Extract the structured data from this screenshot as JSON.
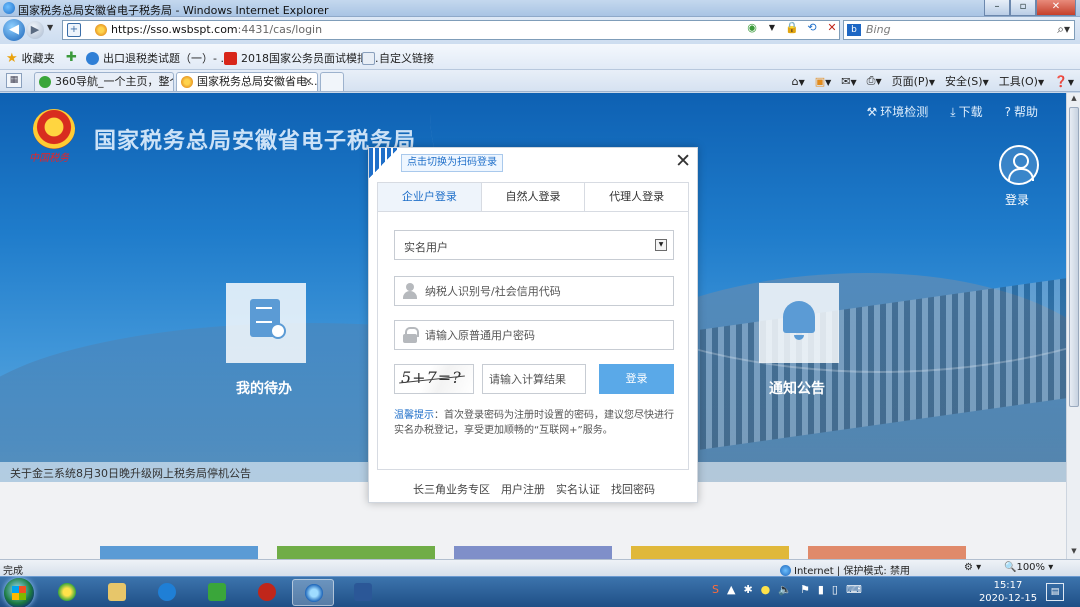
{
  "window": {
    "title": "国家税务总局安徽省电子税务局 - Windows Internet Explorer",
    "min_label": "–",
    "max_label": "▫",
    "close_label": "✕"
  },
  "addressbar": {
    "url_host": "https://sso.wsbspt.com",
    "url_path": ":4431/cas/login",
    "search_placeholder": "Bing",
    "back_glyph": "◀",
    "forward_glyph": "▶"
  },
  "favorites": {
    "label": "收藏夹",
    "items": [
      "出口退税类试题（一）- ...",
      "2018国家公务员面试模拟...",
      "自定义链接"
    ]
  },
  "tabs": [
    {
      "label": "360导航_一个主页，整个..."
    },
    {
      "label": "国家税务总局安徽省电..."
    }
  ],
  "commandbar": {
    "page": "页面(P)",
    "safety": "安全(S)",
    "tools": "工具(O)"
  },
  "site": {
    "title": "国家税务总局安徽省电子税务局",
    "logo_signature": "中国税务",
    "toplinks": [
      "环境检测",
      "下载",
      "帮助"
    ],
    "user_label": "登录",
    "tile_todo": "我的待办",
    "tile_notice": "通知公告",
    "news": "关于金三系统8月30日晚升级网上税务局停机公告"
  },
  "login": {
    "qr_tip": "点击切换为扫码登录",
    "close": "✕",
    "tabs": [
      "企业户登录",
      "自然人登录",
      "代理人登录"
    ],
    "active_tab": 0,
    "select_value": "实名用户",
    "taxid_placeholder": "纳税人识别号/社会信用代码",
    "password_placeholder": "请输入原普通用户密码",
    "captcha_text": "5+7=?",
    "calc_placeholder": "请输入计算结果",
    "submit": "登录",
    "tip_key": "温馨提示",
    "tip_text": "：首次登录密码为注册时设置的密码，建议您尽快进行实名办税登记，享受更加顺畅的“互联网+”服务。",
    "footer_links": [
      "长三角业务专区",
      "用户注册",
      "实名认证",
      "找回密码"
    ]
  },
  "statusbar": {
    "status": "完成",
    "zone": "Internet | 保护模式: 禁用",
    "zoom": "100%"
  },
  "taskbar": {
    "time": "15:17",
    "date": "2020-12-15"
  },
  "colors": {
    "accent": "#1f6fc9",
    "login_button": "#5aa9e8",
    "page_bg_top": "#0e61b3"
  }
}
